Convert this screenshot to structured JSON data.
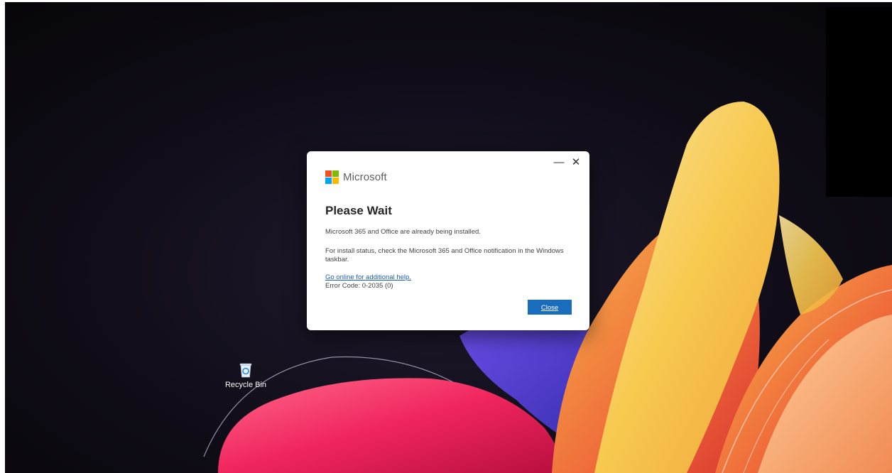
{
  "desktop": {
    "icons": [
      {
        "label": "Recycle Bin",
        "icon": "recycle-bin-icon"
      }
    ]
  },
  "dialog": {
    "brand": "Microsoft",
    "logo_colors": [
      "#f25022",
      "#7fba00",
      "#00a4ef",
      "#ffb900"
    ],
    "minimize_glyph": "—",
    "close_glyph": "✕",
    "title": "Please Wait",
    "message_1": "Microsoft 365 and Office are already being installed.",
    "message_2": "For install status, check the Microsoft 365 and Office notification in the Windows taskbar.",
    "help_link": "Go online for additional help.",
    "error_code": "Error Code: 0-2035 (0)",
    "close_button": "Close",
    "accent_color": "#1a6dbd"
  }
}
